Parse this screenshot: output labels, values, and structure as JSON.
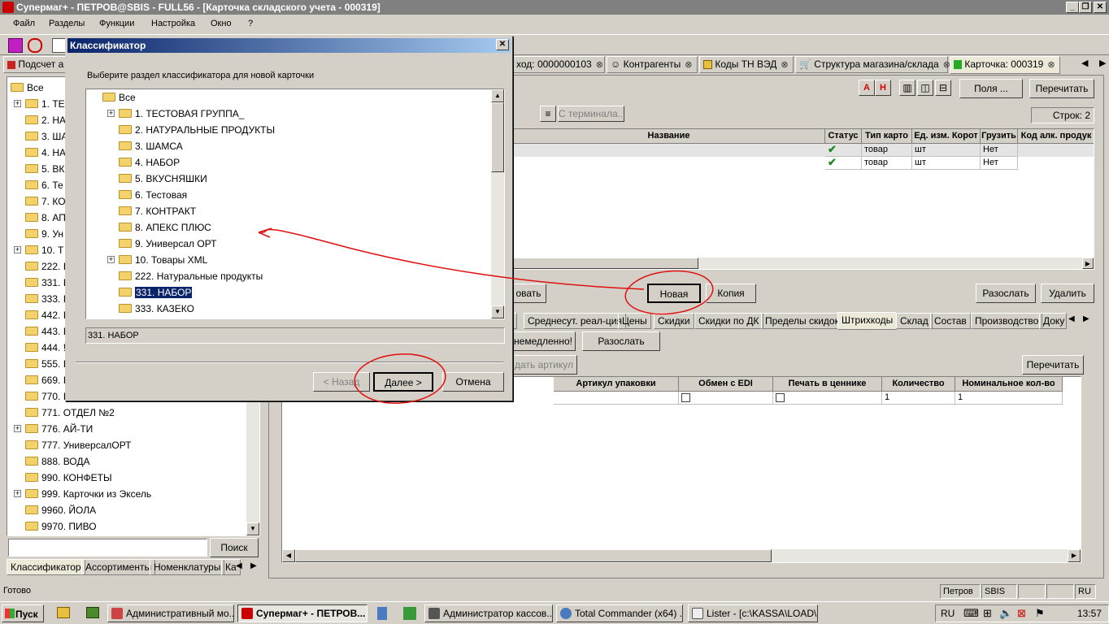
{
  "window": {
    "title": "Супермаг+ - ПЕТРОВ@SBIS - FULL56  - [Карточка складского учета - 000319]",
    "minimize": "_",
    "restore": "❐",
    "close": "✕"
  },
  "menu": [
    "Файл",
    "Разделы",
    "Функции",
    "Настройка",
    "Окно",
    "?"
  ],
  "toolbar": {
    "podschet": "Подсчет а"
  },
  "doc_tabs": [
    {
      "label": "ход: 0000000103"
    },
    {
      "label": "Контрагенты"
    },
    {
      "label": "Коды ТН ВЭД"
    },
    {
      "label": "Структура магазина/склада"
    },
    {
      "label": "Карточка: 000319"
    }
  ],
  "left_tree": {
    "root": "Все",
    "items": [
      "1. ТЕ",
      "2. НА",
      "3. ША",
      "4. НА",
      "5. ВК",
      "6. Те",
      "7. КО",
      "8. АП",
      "9. Ун",
      "10. Т",
      "222. I",
      "331. I",
      "333. I",
      "442. I",
      "443. I",
      "444. !",
      "555. I",
      "669. I",
      "770. I",
      "771. ОТДЕЛ №2",
      "776. АЙ-ТИ",
      "777. УниверсалОРТ",
      "888. ВОДА",
      "990. КОНФЕТЫ",
      "999. Карточки из Эксель",
      "9960. ЙОЛА",
      "9970. ПИВО"
    ],
    "search_button": "Поиск",
    "bottom_tabs": [
      "Классификатор",
      "Ассортименты",
      "Номенклатуры",
      "Ка"
    ]
  },
  "right": {
    "btn_a": "A",
    "btn_h": "H",
    "fields_button": "Поля ...",
    "reread_button": "Перечитать",
    "terminal_button": "С терминала...",
    "rows_label": "Строк: 2",
    "grid_headers": [
      "Название",
      "Статус",
      "Тип карто",
      "Ед. изм. Корот",
      "Грузить",
      "Код алк. продук"
    ],
    "grid_rows": [
      {
        "type": "товар",
        "unit": "шт",
        "load": "Нет"
      },
      {
        "type": "товар",
        "unit": "шт",
        "load": "Нет"
      }
    ],
    "partial_button": "овать",
    "new_button": "Новая",
    "copy_button": "Копия",
    "send_button": "Разослать",
    "delete_button": "Удалить",
    "sub_tabs": [
      "з",
      "Среднесут. реал-ция",
      "Цены",
      "Скидки",
      "Скидки по ДК",
      "Пределы скидок",
      "Штрихкоды",
      "Склад",
      "Состав",
      "Производство",
      "Доку"
    ],
    "now_button": "немедленно!",
    "send2_button": "Разослать",
    "article_button": "дать артикул",
    "reread2_button": "Перечитать",
    "barcode_headers": [
      "Артикул упаковки",
      "Обмен с EDI",
      "Печать в ценнике",
      "Количество",
      "Номинальное кол-во"
    ],
    "barcode_row": {
      "qty": "1",
      "nominal": "1"
    }
  },
  "dialog": {
    "title": "Классификатор",
    "prompt": "Выберите раздел классификатора для новой карточки",
    "root": "Все",
    "items": [
      "1. ТЕСТОВАЯ ГРУППА_",
      "2. НАТУРАЛЬНЫЕ ПРОДУКТЫ",
      "3. ШАМСА",
      "4. НАБОР",
      "5. ВКУСНЯШКИ",
      "6. Тестовая",
      "7. КОНТРАКТ",
      "8. АПЕКС ПЛЮС",
      "9. Универсал ОРТ",
      "10. Товары XML",
      "222. Натуральные продукты",
      "331. НАБОР",
      "333. КАЗЕКО"
    ],
    "selected": "331. НАБОР",
    "path": "331. НАБОР",
    "back_button": "< Назад",
    "next_button": "Далее >",
    "cancel_button": "Отмена"
  },
  "statusbar": {
    "text": "Готово",
    "user": "Петров",
    "sbis": "SBIS",
    "lang": "RU"
  },
  "taskbar": {
    "start": "Пуск",
    "tasks": [
      "Административный мо...",
      "Супермаг+ - ПЕТРОВ...",
      "Администратор кассов...",
      "Total Commander (x64) ...",
      "Lister - [c:\\KASSA\\LOAD\\..."
    ],
    "lang": "RU",
    "clock": "13:57"
  },
  "colors": {
    "annotation": "#e01010",
    "dialog_title": "#0a246a",
    "selection": "#0a246a"
  }
}
